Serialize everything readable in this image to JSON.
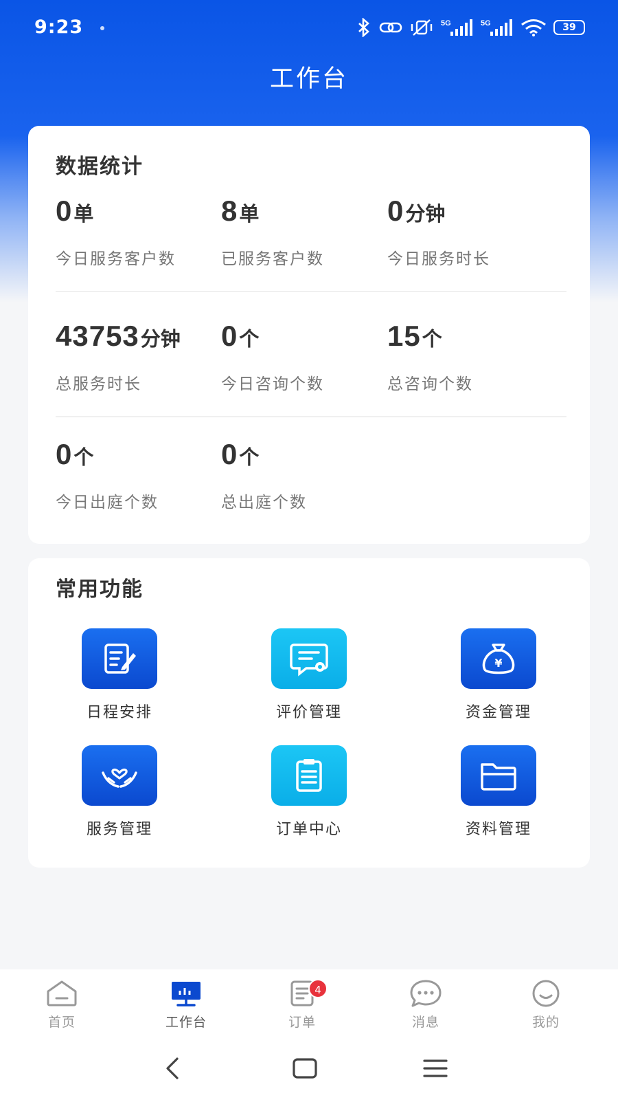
{
  "status_bar": {
    "time": "9:23",
    "battery": "39"
  },
  "header": {
    "title": "工作台"
  },
  "stats": {
    "title": "数据统计",
    "items": [
      {
        "value": "0",
        "unit": "单",
        "label": "今日服务客户数"
      },
      {
        "value": "8",
        "unit": "单",
        "label": "已服务客户数"
      },
      {
        "value": "0",
        "unit": "分钟",
        "label": "今日服务时长"
      },
      {
        "value": "43753",
        "unit": "分钟",
        "label": "总服务时长"
      },
      {
        "value": "0",
        "unit": "个",
        "label": "今日咨询个数"
      },
      {
        "value": "15",
        "unit": "个",
        "label": "总咨询个数"
      },
      {
        "value": "0",
        "unit": "个",
        "label": "今日出庭个数"
      },
      {
        "value": "0",
        "unit": "个",
        "label": "总出庭个数"
      }
    ]
  },
  "functions": {
    "title": "常用功能",
    "items": [
      {
        "label": "日程安排",
        "icon": "schedule-edit-icon",
        "color": "#0b57e0"
      },
      {
        "label": "评价管理",
        "icon": "review-message-icon",
        "color": "#12bdf0"
      },
      {
        "label": "资金管理",
        "icon": "money-bag-icon",
        "color": "#0b57e0"
      },
      {
        "label": "服务管理",
        "icon": "hands-heart-icon",
        "color": "#0b57e0"
      },
      {
        "label": "订单中心",
        "icon": "clipboard-icon",
        "color": "#12bdf0"
      },
      {
        "label": "资料管理",
        "icon": "folder-icon",
        "color": "#0b57e0"
      }
    ]
  },
  "tabbar": {
    "items": [
      {
        "label": "首页",
        "icon": "home-icon",
        "active": false
      },
      {
        "label": "工作台",
        "icon": "workbench-icon",
        "active": true
      },
      {
        "label": "订单",
        "icon": "order-icon",
        "active": false,
        "badge": "4"
      },
      {
        "label": "消息",
        "icon": "message-icon",
        "active": false
      },
      {
        "label": "我的",
        "icon": "profile-icon",
        "active": false
      }
    ]
  },
  "colors": {
    "primary": "#0b57e0",
    "accent_cyan": "#12bdf0",
    "badge": "#e8323c"
  }
}
